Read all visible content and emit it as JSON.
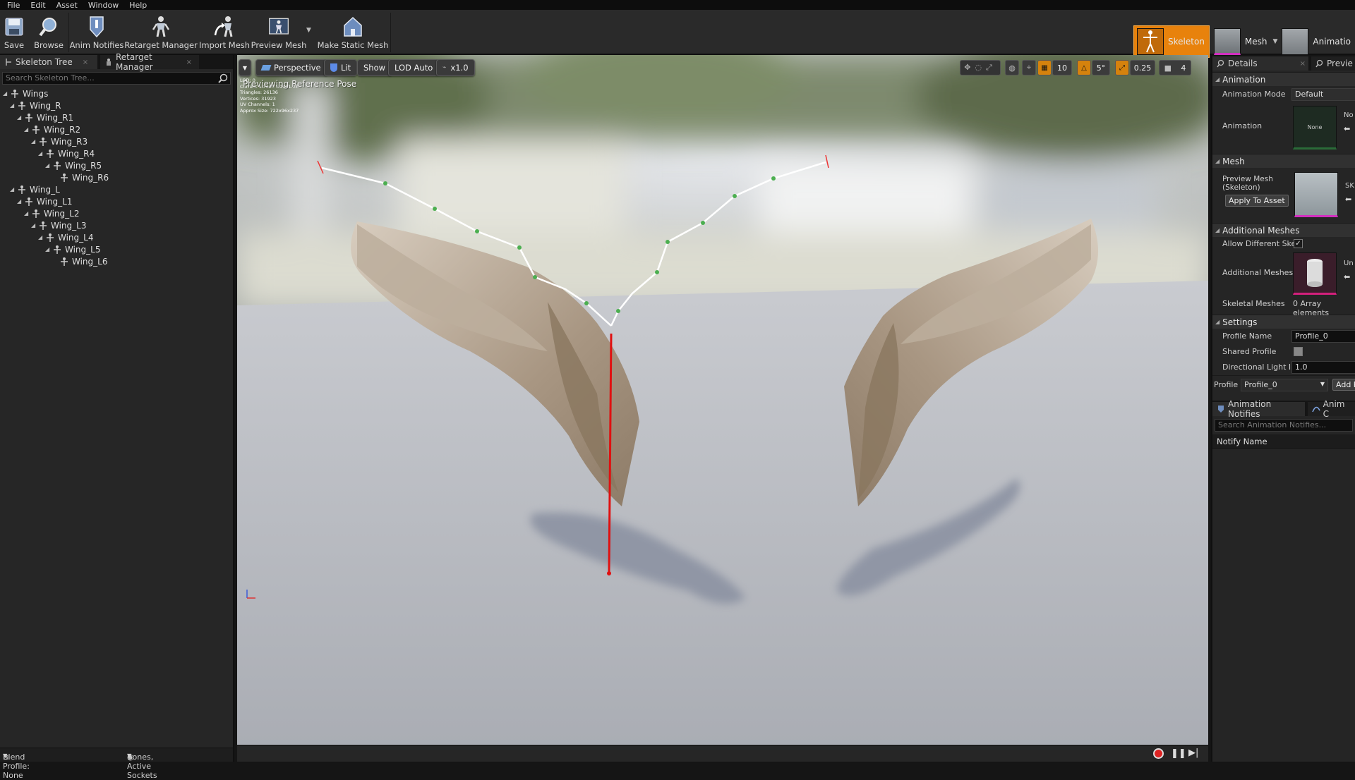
{
  "menu": [
    "File",
    "Edit",
    "Asset",
    "Window",
    "Help"
  ],
  "toolbar": {
    "save": "Save",
    "browse": "Browse",
    "anim_notifies": "Anim Notifies",
    "retarget_manager": "Retarget Manager",
    "import_mesh": "Import Mesh",
    "preview_mesh": "Preview Mesh",
    "make_static_mesh": "Make Static Mesh"
  },
  "modes": {
    "skeleton": "Skeleton",
    "mesh": "Mesh",
    "animation": "Animatio"
  },
  "left_panel": {
    "tab_skeleton_tree": "Skeleton Tree",
    "tab_retarget_manager": "Retarget Manager",
    "search_placeholder": "Search Skeleton Tree...",
    "tree": [
      {
        "label": "Wings"
      },
      {
        "label": "Wing_R"
      },
      {
        "label": "Wing_R1"
      },
      {
        "label": "Wing_R2"
      },
      {
        "label": "Wing_R3"
      },
      {
        "label": "Wing_R4"
      },
      {
        "label": "Wing_R5"
      },
      {
        "label": "Wing_R6"
      },
      {
        "label": "Wing_L"
      },
      {
        "label": "Wing_L1"
      },
      {
        "label": "Wing_L2"
      },
      {
        "label": "Wing_L3"
      },
      {
        "label": "Wing_L4"
      },
      {
        "label": "Wing_L5"
      },
      {
        "label": "Wing_L6"
      }
    ],
    "footer_blend_profile": "Blend Profile: None",
    "footer_bones": "Bones, Active Sockets"
  },
  "viewport": {
    "perspective": "Perspective",
    "lit": "Lit",
    "show": "Show",
    "lod": "LOD Auto",
    "speed": "x1.0",
    "grid_snap": "10",
    "rot_snap": "5°",
    "scale_snap": "0.25",
    "camera_speed": "4",
    "preview_label": "Previewing Reference Pose",
    "stats": [
      "LOD: 0",
      "Current Screen Size: 1.22",
      "Triangles: 26136",
      "Vertices: 31923",
      "UV Channels: 1",
      "Approx Size: 722x96x237"
    ]
  },
  "right_panel": {
    "tab_details": "Details",
    "tab_preview": "Previe",
    "section_animation": "Animation",
    "animation_mode_label": "Animation Mode",
    "animation_mode_value": "Default",
    "animation_label": "Animation",
    "animation_none": "None",
    "animation_clip": "No",
    "section_mesh": "Mesh",
    "preview_mesh_label": "Preview Mesh (Skeleton)",
    "apply_to_asset": "Apply To Asset",
    "mesh_clip": "SK",
    "section_additional": "Additional Meshes",
    "allow_different": "Allow Different Skel",
    "additional_meshes": "Additional Meshes",
    "additional_clip": "Un",
    "skeletal_meshes": "Skeletal Meshes",
    "skeletal_meshes_value": "0 Array elements",
    "section_settings": "Settings",
    "profile_name_label": "Profile Name",
    "profile_name_value": "Profile_0",
    "shared_profile": "Shared Profile",
    "directional_light": "Directional Light Int",
    "directional_light_value": "1.0",
    "profile_label": "Profile",
    "profile_value": "Profile_0",
    "add_profile": "Add P",
    "tab_anim_notifies": "Animation Notifies",
    "tab_anim_clip": "Anim C",
    "notifies_search": "Search Animation Notifies...",
    "notify_name": "Notify Name"
  },
  "colors": {
    "accent": "#e8820c",
    "background": "#151515",
    "panel": "#262626"
  }
}
